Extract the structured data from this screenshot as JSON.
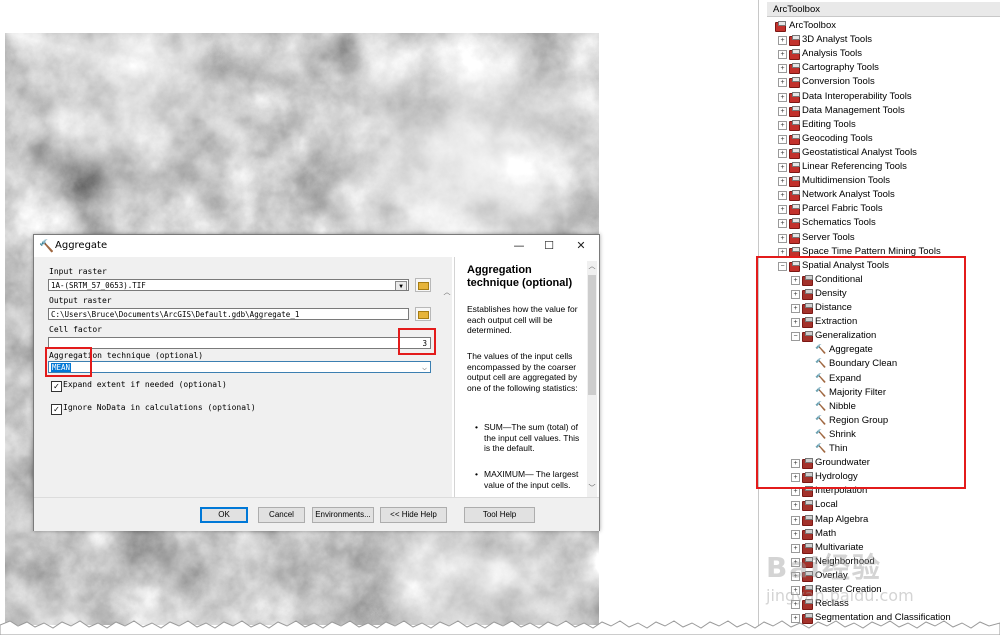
{
  "dialog": {
    "title": "Aggregate",
    "icon": "hammer-icon",
    "window_buttons": {
      "minimize": "—",
      "maximize": "☐",
      "close": "✕"
    },
    "fields": {
      "input_raster_label": "Input raster",
      "input_raster_value": "1A-(SRTM_57_0653).TIF",
      "output_raster_label": "Output raster",
      "output_raster_value": "C:\\Users\\Bruce\\Documents\\ArcGIS\\Default.gdb\\Aggregate_1",
      "cell_factor_label": "Cell factor",
      "cell_factor_value": "3",
      "aggregation_label": "Aggregation technique (optional)",
      "aggregation_value": "MEAN",
      "expand_extent_label": "Expand extent if needed (optional)",
      "expand_extent_checked": true,
      "ignore_nodata_label": "Ignore NoData in calculations (optional)",
      "ignore_nodata_checked": true
    },
    "help": {
      "title": "Aggregation technique (optional)",
      "p1": "Establishes how the value for each output cell will be determined.",
      "p2": "The values of the input cells encompassed by the coarser output cell are aggregated by one of the following statistics:",
      "bullet1": "SUM—The sum (total) of the input cell values. This is the default.",
      "bullet2": "MAXIMUM— The largest value of the input cells."
    },
    "buttons": {
      "ok": "OK",
      "cancel": "Cancel",
      "environments": "Environments...",
      "hide_help": "<< Hide Help",
      "tool_help": "Tool Help"
    }
  },
  "toolbox": {
    "title": "ArcToolbox",
    "root": "ArcToolbox",
    "toolsets": [
      "3D Analyst Tools",
      "Analysis Tools",
      "Cartography Tools",
      "Conversion Tools",
      "Data Interoperability Tools",
      "Data Management Tools",
      "Editing Tools",
      "Geocoding Tools",
      "Geostatistical Analyst Tools",
      "Linear Referencing Tools",
      "Multidimension Tools",
      "Network Analyst Tools",
      "Parcel Fabric Tools",
      "Schematics Tools",
      "Server Tools",
      "Space Time Pattern Mining Tools"
    ],
    "spatial_analyst": {
      "label": "Spatial Analyst Tools",
      "subsets_before": [
        "Conditional",
        "Density",
        "Distance",
        "Extraction"
      ],
      "generalization": {
        "label": "Generalization",
        "tools": [
          "Aggregate",
          "Boundary Clean",
          "Expand",
          "Majority Filter",
          "Nibble",
          "Region Group",
          "Shrink",
          "Thin"
        ]
      },
      "subsets_after": [
        "Groundwater",
        "Hydrology",
        "Interpolation",
        "Local",
        "Map Algebra",
        "Math",
        "Multivariate",
        "Neighborhood",
        "Overlay",
        "Raster Creation",
        "Reclass",
        "Segmentation and Classification"
      ]
    }
  },
  "watermark": {
    "main": "Bai经验",
    "sub": "jingyan.baidu.com"
  }
}
